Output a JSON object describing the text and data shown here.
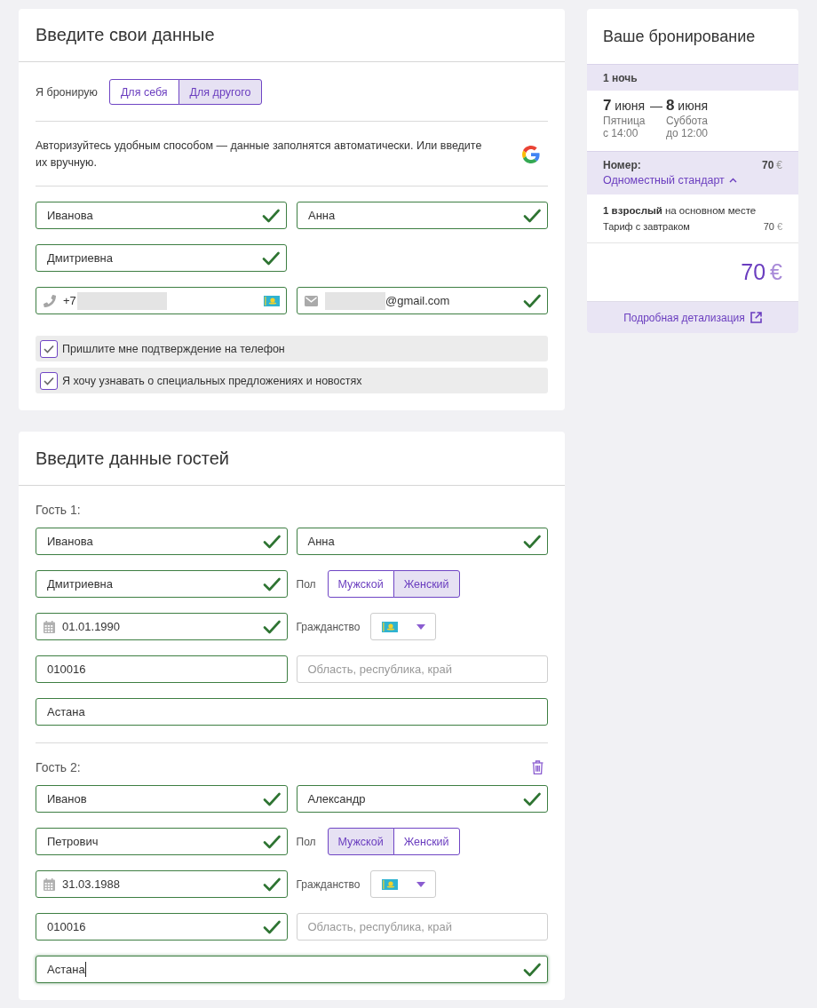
{
  "contact": {
    "title": "Введите свои данные",
    "booking_for": {
      "label": "Я бронирую",
      "options": [
        {
          "label": "Для себя",
          "selected": false
        },
        {
          "label": "Для другого",
          "selected": true
        }
      ]
    },
    "auth_text": "Авторизуйтесь удобным способом — данные заполнятся автоматически. Или введите их вручную.",
    "rows": [
      [
        {
          "kind": "surname",
          "value": "Иванова",
          "valid": true,
          "check": true
        },
        {
          "kind": "first-name",
          "value": "Анна",
          "valid": true,
          "check": true
        }
      ],
      [
        {
          "kind": "patronymic",
          "value": "Дмитриевна",
          "valid": true,
          "check": true
        }
      ],
      [
        {
          "kind": "phone",
          "value": "+7",
          "redacted": true,
          "valid": true,
          "check": false
        },
        {
          "kind": "email",
          "value": "@gmail.com",
          "redacted": true,
          "valid": true,
          "check": true
        }
      ]
    ],
    "checkboxes": [
      {
        "label": "Пришлите мне подтверждение на телефон",
        "checked": true
      },
      {
        "label": "Я хочу узнавать о специальных предложениях и новостях",
        "checked": true
      }
    ]
  },
  "guests": {
    "title": "Введите данные гостей",
    "items": [
      {
        "label": "Гость 1:",
        "removable": false,
        "surname": {
          "value": "Иванова",
          "valid": true,
          "check": true
        },
        "first_name": {
          "value": "Анна",
          "valid": true,
          "check": true
        },
        "patronymic": {
          "value": "Дмитриевна",
          "valid": true,
          "check": true
        },
        "gender": {
          "label": "Пол",
          "options": [
            {
              "label": "Мужской",
              "selected": false
            },
            {
              "label": "Женский",
              "selected": true
            }
          ]
        },
        "birth_date": {
          "value": "01.01.1990",
          "valid": true,
          "check": true
        },
        "citizenship": {
          "label": "Гражданство"
        },
        "postcode": {
          "value": "010016",
          "valid": true,
          "check": false
        },
        "region": {
          "placeholder": "Область, республика, край",
          "valid": false,
          "check": false
        },
        "city": {
          "value": "Астана",
          "valid": true,
          "check": false,
          "focused": false
        }
      },
      {
        "label": "Гость 2:",
        "removable": true,
        "surname": {
          "value": "Иванов",
          "valid": true,
          "check": true
        },
        "first_name": {
          "value": "Александр",
          "valid": true,
          "check": true
        },
        "patronymic": {
          "value": "Петрович",
          "valid": true,
          "check": true
        },
        "gender": {
          "label": "Пол",
          "options": [
            {
              "label": "Мужской",
              "selected": true
            },
            {
              "label": "Женский",
              "selected": false
            }
          ]
        },
        "birth_date": {
          "value": "31.03.1988",
          "valid": true,
          "check": true
        },
        "citizenship": {
          "label": "Гражданство"
        },
        "postcode": {
          "value": "010016",
          "valid": true,
          "check": true
        },
        "region": {
          "placeholder": "Область, республика, край",
          "valid": false,
          "check": false
        },
        "city": {
          "value": "Астана",
          "valid": true,
          "check": true,
          "focused": true
        }
      }
    ]
  },
  "summary": {
    "title": "Ваше бронирование",
    "nights": "1 ночь",
    "check_in": {
      "date": "**7** июня",
      "weekday": "Пятница",
      "time": "с 14:00"
    },
    "separator": "—",
    "check_out": {
      "date": "**8** июня",
      "weekday": "Суббота",
      "time": "до 12:00"
    },
    "room": {
      "label": "Номер:",
      "price": "70",
      "currency": "€",
      "name": "Одноместный стандарт",
      "expanded": true
    },
    "occupancy": "**1 взрослый** на основном месте",
    "tariff": {
      "label": "Тариф с завтраком",
      "price": "70",
      "currency": "€"
    },
    "total": {
      "amount": "70",
      "currency": "€"
    },
    "details_link": "Подробная детализация"
  }
}
